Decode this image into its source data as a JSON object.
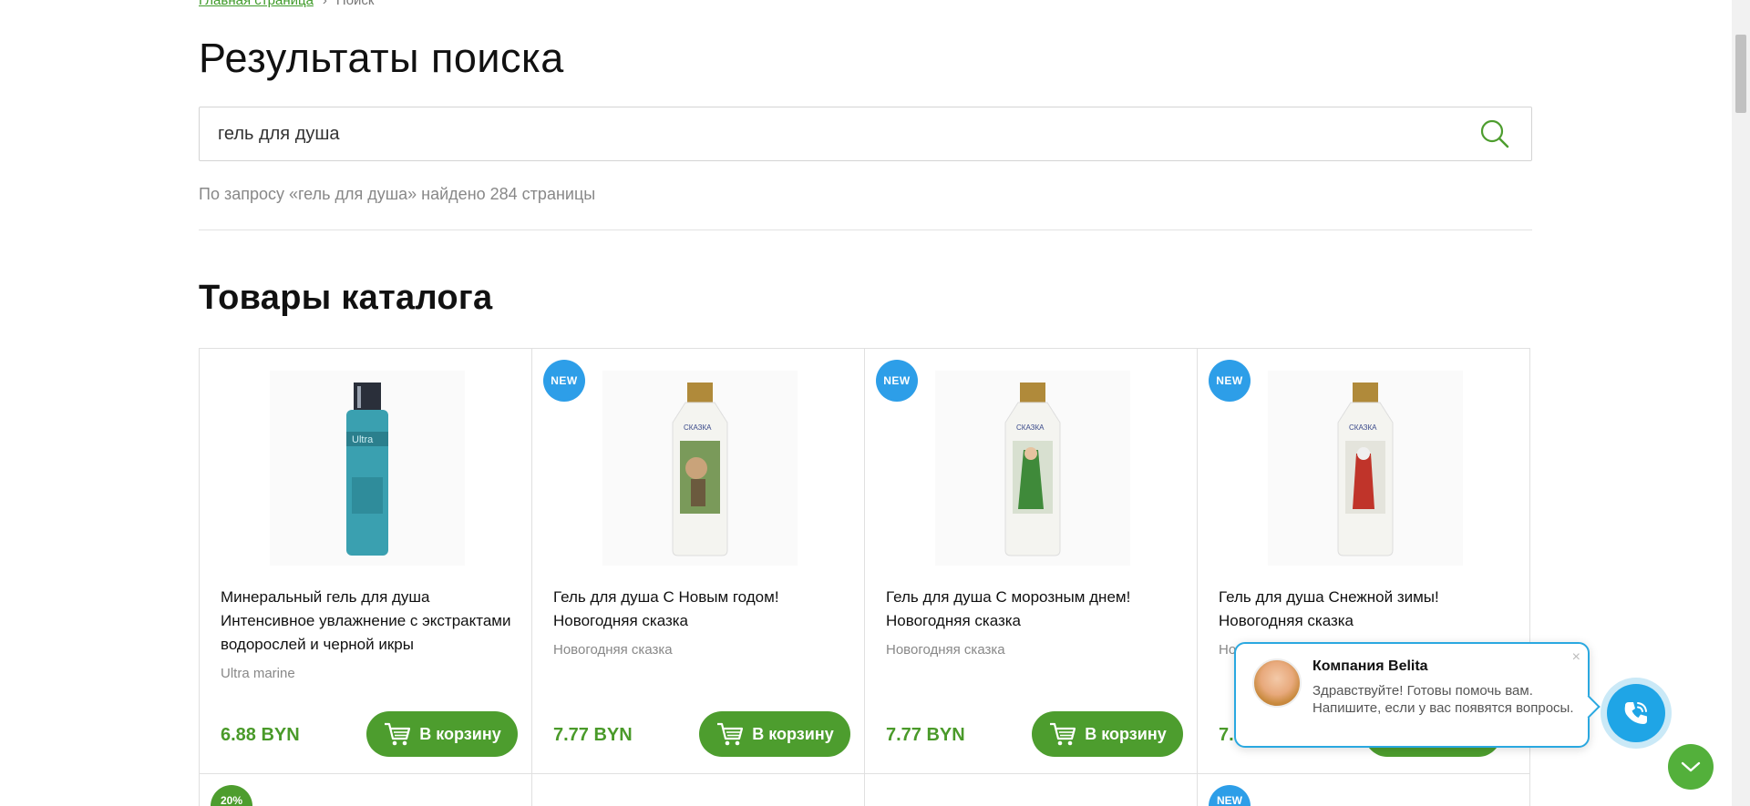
{
  "breadcrumb": {
    "home": "Главная страница",
    "separator": "›",
    "current": "Поиск"
  },
  "page_title": "Результаты поиска",
  "search": {
    "value": "гель для душа",
    "icon": "search-icon"
  },
  "result_count": "По запросу «гель для душа» найдено 284 страницы",
  "section_title": "Товары каталога",
  "products": [
    {
      "badge": "",
      "name": "Минеральный гель для душа Интенсивное увлажнение с экстрактами водорослей и черной икры",
      "brand": "Ultra marine",
      "price": "6.88 BYN",
      "cart_label": "В корзину"
    },
    {
      "badge": "NEW",
      "name": "Гель для душа С Новым годом! Новогодняя сказка",
      "brand": "Новогодняя сказка",
      "price": "7.77 BYN",
      "cart_label": "В корзину"
    },
    {
      "badge": "NEW",
      "name": "Гель для душа С морозным днем! Новогодняя сказка",
      "brand": "Новогодняя сказка",
      "price": "7.77 BYN",
      "cart_label": "В корзину"
    },
    {
      "badge": "NEW",
      "name": "Гель для душа Снежной зимы! Новогодняя сказка",
      "brand": "Но",
      "price": "7.",
      "cart_label": ""
    }
  ],
  "row2_badges": [
    "20%",
    "",
    "",
    "NEW"
  ],
  "chat": {
    "company": "Компания Belita",
    "message": "Здравствуйте! Готовы помочь вам. Напишите, если у вас появятся вопросы.",
    "close": "×"
  },
  "colors": {
    "accent_green": "#4d9d2e",
    "badge_blue": "#2d9ee8",
    "chat_blue": "#1fa5e6"
  }
}
